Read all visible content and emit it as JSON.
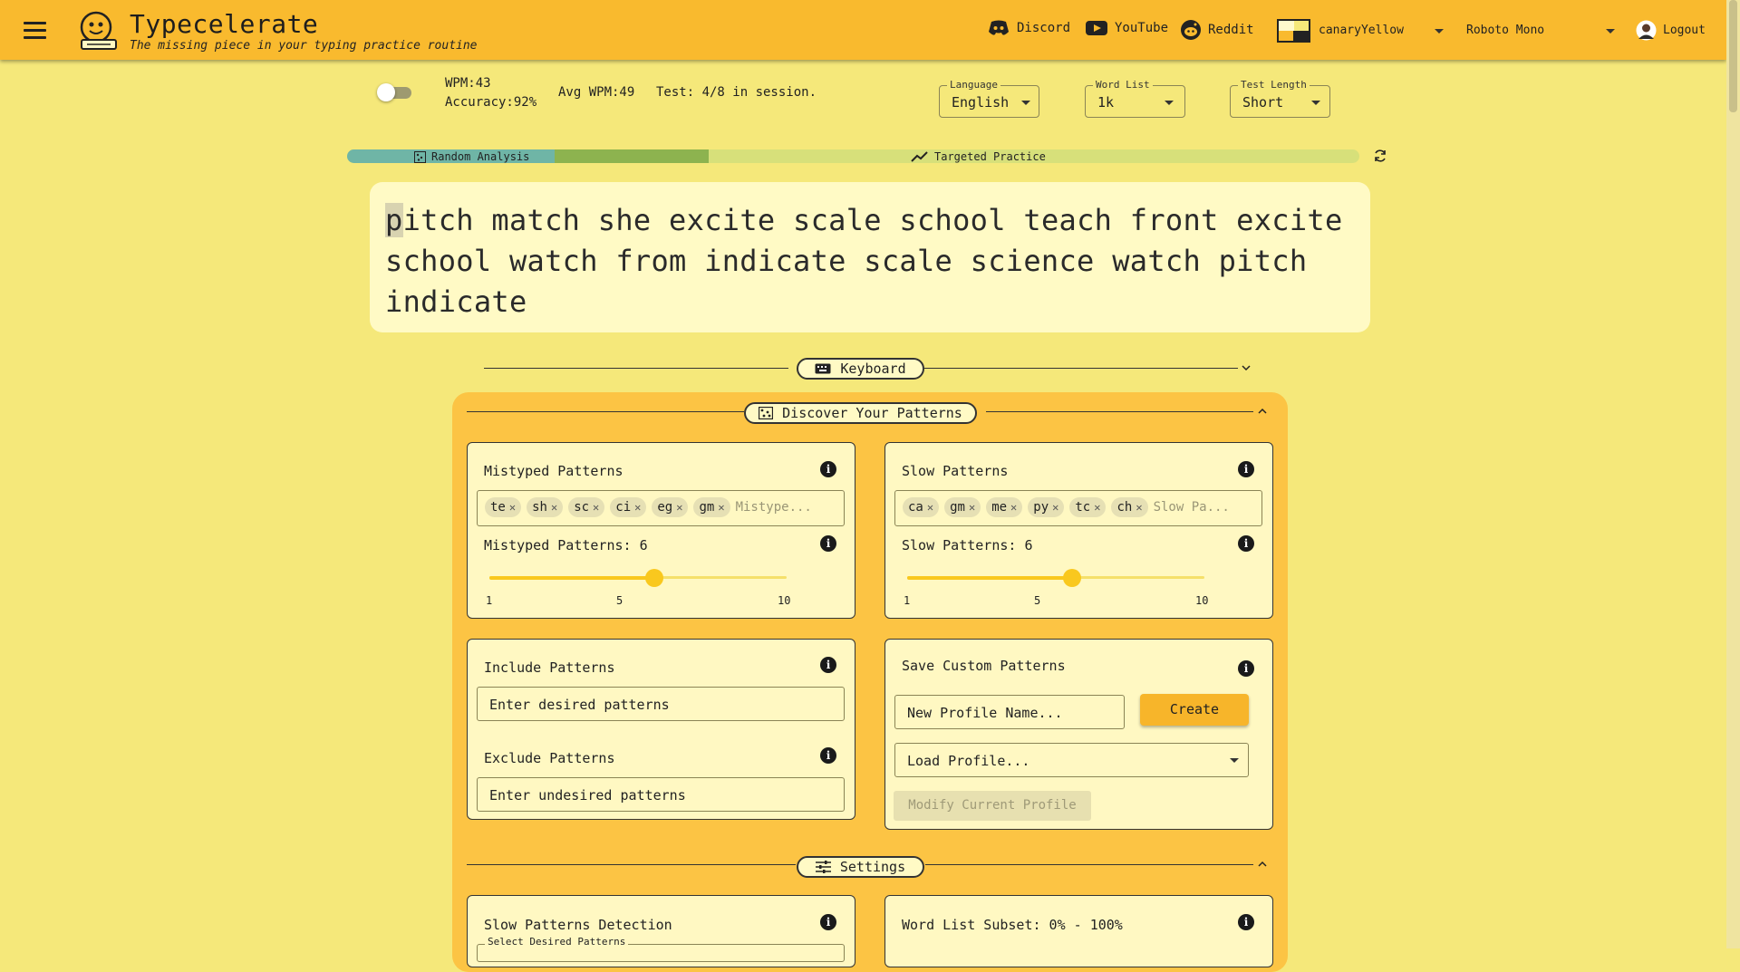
{
  "header": {
    "title": "Typecelerate",
    "subtitle": "The missing piece in your typing practice routine",
    "links": [
      {
        "label": "Discord",
        "icon": "discord-icon"
      },
      {
        "label": "YouTube",
        "icon": "youtube-icon"
      },
      {
        "label": "Reddit",
        "icon": "reddit-icon"
      }
    ],
    "theme": "canaryYellow",
    "font": "Roboto Mono",
    "logout": "Logout"
  },
  "stats": {
    "wpm": "WPM:43",
    "accuracy": "Accuracy:92%",
    "avg_wpm": "Avg WPM:49",
    "test": "Test: 4/8 in session."
  },
  "selects": {
    "language": {
      "label": "Language",
      "value": "English"
    },
    "word_list": {
      "label": "Word List",
      "value": "1k"
    },
    "test_length": {
      "label": "Test Length",
      "value": "Short"
    }
  },
  "progress": {
    "random_label": "Random Analysis",
    "targeted_label": "Targeted Practice",
    "random_fraction": 0.205,
    "done_fraction": 0.357
  },
  "typing": {
    "first_char": "p",
    "text": "itch match she excite scale school teach front excite school watch from indicate scale science watch pitch indicate"
  },
  "sections": {
    "keyboard": "Keyboard",
    "discover": "Discover Your Patterns",
    "settings": "Settings"
  },
  "mistyped": {
    "title": "Mistyped Patterns",
    "chips": [
      "te",
      "sh",
      "sc",
      "ci",
      "eg",
      "gm"
    ],
    "placeholder": "Mistype...",
    "count_label": "Mistyped Patterns: 6",
    "value": 6,
    "ticks": [
      "1",
      "5",
      "10"
    ]
  },
  "slow": {
    "title": "Slow Patterns",
    "chips": [
      "ca",
      "gm",
      "me",
      "py",
      "tc",
      "ch"
    ],
    "placeholder": "Slow Pa...",
    "count_label": "Slow Patterns: 6",
    "value": 6,
    "ticks": [
      "1",
      "5",
      "10"
    ]
  },
  "include": {
    "title": "Include Patterns",
    "placeholder": "Enter desired patterns"
  },
  "exclude": {
    "title": "Exclude Patterns",
    "placeholder": "Enter undesired patterns"
  },
  "custom": {
    "title": "Save Custom Patterns",
    "profile_placeholder": "New Profile Name...",
    "create": "Create",
    "load": "Load Profile...",
    "modify": "Modify Current Profile"
  },
  "bottom": {
    "slow_detection": "Slow Patterns Detection",
    "select_desired": "Select Desired Patterns",
    "word_subset": "Word List Subset: 0% - 100%"
  },
  "colors": {
    "header": "#f9ba2e",
    "background": "#f5e87a",
    "panel": "#fcc444",
    "card": "#fff8c2",
    "accent": "#f9c81e"
  }
}
